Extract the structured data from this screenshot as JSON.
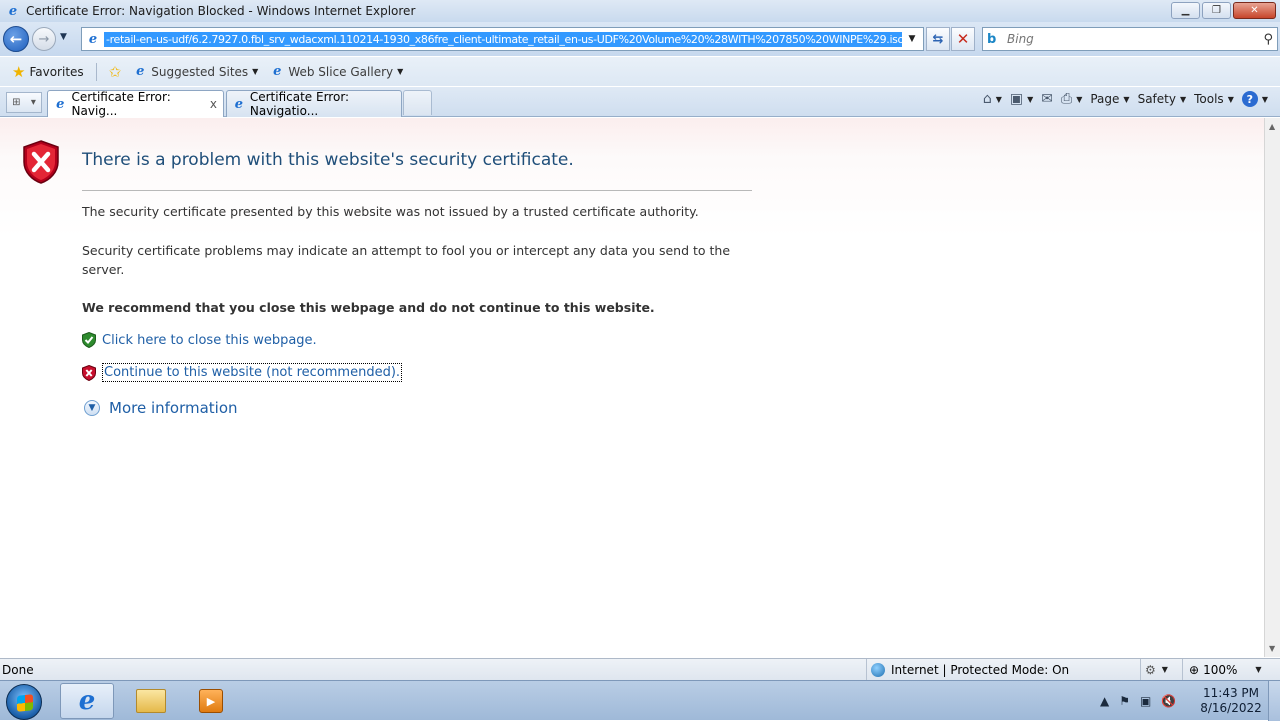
{
  "window": {
    "title": "Certificate Error: Navigation Blocked - Windows Internet Explorer",
    "minimize_label": "▁",
    "maximize_label": "❐",
    "close_label": "✕"
  },
  "navigation": {
    "address_url": "-retail-en-us-udf/6.2.7927.0.fbl_srv_wdacxml.110214-1930_x86fre_client-ultimate_retail_en-us-UDF%20Volume%20%28WITH%207850%20WINPE%29.iso",
    "search_placeholder": "Bing"
  },
  "favorites_bar": {
    "favorites_label": "Favorites",
    "suggested_sites_label": "Suggested Sites",
    "web_slice_gallery_label": "Web Slice Gallery"
  },
  "tabs": [
    {
      "label": "Certificate Error: Navig...",
      "close": "x"
    },
    {
      "label": "Certificate Error: Navigatio..."
    }
  ],
  "command_bar": {
    "page_label": "Page",
    "safety_label": "Safety",
    "tools_label": "Tools",
    "help_label": "?"
  },
  "content": {
    "heading": "There is a problem with this website's security certificate.",
    "paragraph1": "The security certificate presented by this website was not issued by a trusted certificate authority.",
    "paragraph2": "Security certificate problems may indicate an attempt to fool you or intercept any data you send to the server.",
    "recommendation": "We recommend that you close this webpage and do not continue to this website.",
    "close_link": "Click here to close this webpage.",
    "continue_link": "Continue to this website (not recommended).",
    "more_info": "More information"
  },
  "status_bar": {
    "status_text": "Done",
    "zone_text": "Internet | Protected Mode: On",
    "zoom_text": "100%"
  },
  "taskbar": {
    "time": "11:43 PM",
    "date": "8/16/2022"
  },
  "colors": {
    "link": "#1f5fa6",
    "heading": "#1f4e79",
    "url_highlight": "#3399ff"
  }
}
